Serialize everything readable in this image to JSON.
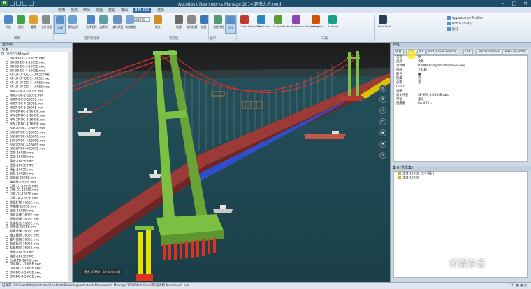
{
  "titlebar": {
    "title": "Autodesk Navisworks Manage 2014  跨海大桥.nwd",
    "app_letter": "N",
    "min": "–",
    "max": "□",
    "close": "✕"
  },
  "tabs": [
    "常用",
    "视点",
    "审阅",
    "动画",
    "查看",
    "输出",
    "BIM 360",
    "渲染"
  ],
  "ribbon": {
    "buttons": [
      {
        "label": "附加",
        "color": "#4f86c6"
      },
      {
        "label": "刷新",
        "color": "#3fa34d"
      },
      {
        "label": "重置",
        "color": "#e0a030"
      },
      {
        "label": "文件选项",
        "color": "#8c8c8c"
      },
      {
        "label": "选择",
        "color": "#5b8fc7"
      },
      {
        "label": "保存选择",
        "color": "#6a9fd4"
      },
      {
        "label": "选择相同",
        "color": "#4f86c6"
      },
      {
        "label": "选择树",
        "color": "#5f9ea0"
      },
      {
        "label": "查找项目",
        "color": "#6a8fc0"
      },
      {
        "label": "快速查找",
        "color": "#7aa7d8"
      },
      {
        "label": "集合",
        "color": "#d48a2a"
      },
      {
        "label": "隐藏",
        "color": "#6b6b6b"
      },
      {
        "label": "取消隐藏",
        "color": "#8a8a8a"
      },
      {
        "label": "链接",
        "color": "#3c78b5"
      },
      {
        "label": "快捷特性",
        "color": "#4f9d6e"
      },
      {
        "label": "特性",
        "color": "#5b8fc7"
      },
      {
        "label": "Clash Detective",
        "color": "#c0392b"
      },
      {
        "label": "TimeLiner",
        "color": "#2e86c1"
      },
      {
        "label": "Quantification",
        "color": "#5d9b3a"
      },
      {
        "label": "Autodesk Rendering",
        "color": "#8e44ad"
      },
      {
        "label": "Animator",
        "color": "#d35400"
      },
      {
        "label": "Scripter",
        "color": "#16a085"
      },
      {
        "label": "DataTools",
        "color": "#2c3e50"
      }
    ],
    "small": [
      "Appearance Profiler",
      "Batch Utility",
      "比较"
    ],
    "input_value": "CONFIG",
    "groups": [
      "项目",
      "选择和搜索",
      "可见性",
      "显示",
      "工具"
    ]
  },
  "left_panel": {
    "title": "选择树",
    "subhead": "标准",
    "items": [
      "06-SEG-NF.nwd",
      "BB-BB-DC-1-1605E.nwc",
      "BB-BB-DC-2-1605E.nwc",
      "BB-BB-DC-3-1605E.nwc",
      "BB-BB-DC-4-1605E.nwc",
      "KP-LB-DF-DC-1-1605E.nwc",
      "KP-LB-DF-DC-2-1605E.nwc",
      "KP-LB-DF-DC-3-1605E.nwc",
      "KP-LB-DF-DC-4-1605E.nwc",
      "NBKT-DC-1-1605E.nwc",
      "NBKT-DC-2-1605E.nwc",
      "NBKT-DC-3-1605E.nwc",
      "NBKT-DC-4-1605E.nwc",
      "NBKT-DC-5-1605E.nwc",
      "NW-ZP-DC-1-1605E.nwc",
      "NW-ZP-DC-2-1605E.nwc",
      "NW-ZP-DC-3-1605E.nwc",
      "NW-ZP-DC-4-1605E.nwc",
      "SW-ZP-DC-1-1605E.nwc",
      "SW-ZP-DC-2-1605E.nwc",
      "SW-ZP-DC-3-1605E.nwc",
      "SW-ZP-DC-4-1605E.nwc",
      "SW-ZP-DC-5-1605E.nwc",
      "SW-ZP-DC-6-1605E.nwc",
      "主塔-1605E.nwc",
      "主缆-1605E.nwc",
      "吊索-1605E.nwc",
      "桥面-1605E.nwc",
      "承台-1605E.nwc",
      "桩基-1605E.nwc",
      "北锚碇-1605E.nwc",
      "南锚碇-1605E.nwc",
      "引桥-01-1605E.nwc",
      "引桥-02-1605E.nwc",
      "引桥-03-1605E.nwc",
      "引桥-04-1605E.nwc",
      "防撞护栏-1605E.nwc",
      "伸缩缝-1605E.nwc",
      "支座-1605E.nwc",
      "排水系统-1605E.nwc",
      "照明系统-1605E.nwc",
      "交通标志-1605E.nwc",
      "检修道-1605E.nwc",
      "附属设施-1605E.nwc",
      "施工栈桥-1605E.nwc",
      "临时结构-1605E.nwc",
      "航道标识-1605E.nwc",
      "船舶模型-1605E.nwc",
      "地形-1605E.nwc",
      "海面-1605E.nwc",
      "CAD-TD-1605E.nwc",
      "DM-DC-1-1605E.nwc",
      "DM-DC-2-1605E.nwc",
      "DM-DC-3-1605E.nwc",
      "DM-DC-4-1605E.nwc"
    ]
  },
  "viewport": {
    "label": "视点 [DMO - Undefined]"
  },
  "right_panel": {
    "title": "特性",
    "tabs": [
      "项目",
      "文件",
      "IFC",
      "Part_BaseCommon",
      "LSE",
      "Tekla Common",
      "Tekla Quantity"
    ],
    "active_tab": 1,
    "rows": [
      {
        "k": "名称",
        "v": "桥"
      },
      {
        "k": "类型",
        "v": "文件"
      },
      {
        "k": "源文件",
        "v": "D:\\BIM\\bridge\\model\\tower.dwg"
      },
      {
        "k": "图层",
        "v": "无标题"
      },
      {
        "k": "颜色",
        "v": "■"
      },
      {
        "k": "隐藏",
        "v": "否"
      },
      {
        "k": "必需",
        "v": "否"
      },
      {
        "k": "GUID",
        "v": ""
      },
      {
        "k": "材质",
        "v": ""
      },
      {
        "k": "源文件名",
        "v": "SE-STC-1-1605E.nwc"
      },
      {
        "k": "单位",
        "v": "毫米"
      },
      {
        "k": "创建者",
        "v": "Revit2014"
      }
    ]
  },
  "selection_panel": {
    "title": "集合(选择集)",
    "items": [
      "主塔-1605E（2个项目）",
      "主缆-1605E"
    ]
  },
  "statusbar": {
    "text": "已保存 D:\\Users\\Administrator\\AppData\\Roaming\\Autodesk Navisworks Manage 2014\\AutoSave\\跨海大桥.Autosave0.nwf",
    "right": "1/1  ▦  ▣  ◫"
  },
  "watermark": {
    "text": "桥梁杂志"
  },
  "colors": {
    "sky": "#1a1a1a",
    "sea": "#1f4f5c",
    "tower": "#7bc043",
    "deck": "#9b3a36",
    "cable": "#cc2d2d",
    "lane": "#2f4ec9",
    "pile": "#e8e000"
  }
}
